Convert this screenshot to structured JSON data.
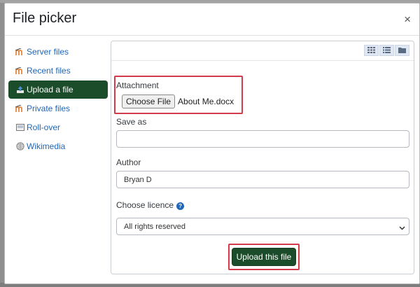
{
  "dialog": {
    "title": "File picker",
    "close_symbol": "×"
  },
  "sidebar": {
    "items": [
      {
        "label": "Server files",
        "icon": "moodle-icon",
        "active": false
      },
      {
        "label": "Recent files",
        "icon": "moodle-icon",
        "active": false
      },
      {
        "label": "Upload a file",
        "icon": "upload-icon",
        "active": true
      },
      {
        "label": "Private files",
        "icon": "moodle-icon",
        "active": false
      },
      {
        "label": "Roll-over",
        "icon": "rollover-icon",
        "active": false
      },
      {
        "label": "Wikimedia",
        "icon": "wikimedia-icon",
        "active": false
      }
    ]
  },
  "toolbar": {
    "view_modes": [
      "icons-view-icon",
      "list-view-icon",
      "tree-view-icon"
    ]
  },
  "form": {
    "attachment_label": "Attachment",
    "choose_file_label": "Choose File",
    "file_name": "About Me.docx",
    "save_as_label": "Save as",
    "save_as_value": "",
    "author_label": "Author",
    "author_value": "Bryan D",
    "licence_label": "Choose licence",
    "licence_value": "All rights reserved",
    "upload_label": "Upload this file"
  },
  "colors": {
    "accent": "#1b4d2a",
    "link": "#1f66b8",
    "highlight": "#d33b4a"
  }
}
